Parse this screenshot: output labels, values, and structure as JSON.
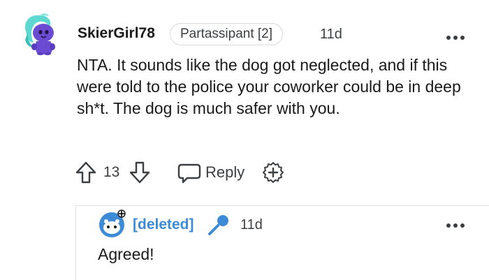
{
  "comment": {
    "username": "SkierGirl78",
    "flair": "Partassipant [2]",
    "timestamp": "11d",
    "body": "NTA. It sounds like the dog got neglected, and if this were told to the police your coworker could be in deep sh*t. The dog is much safer with you.",
    "vote_count": "13",
    "reply_label": "Reply",
    "avatar": "snoo-avatar-icon",
    "more_icon": "more-options-icon",
    "upvote_icon": "arrow-up-icon",
    "downvote_icon": "arrow-down-icon",
    "reply_icon": "speech-bubble-icon",
    "award_icon": "plus-award-icon"
  },
  "reply": {
    "username": "[deleted]",
    "timestamp": "11d",
    "body": "Agreed!",
    "avatar": "deleted-user-avatar-icon",
    "mic_icon": "microphone-icon",
    "more_icon": "more-options-icon"
  },
  "colors": {
    "text_primary": "#1a1a1b",
    "text_secondary": "#3c3f42",
    "deleted_user": "#3d8ad6",
    "flair_border": "#d7d9dc",
    "thread_line": "#e0e1e3",
    "avatar_primary": "#6a4bd1",
    "avatar_hair": "#5fd8d2"
  }
}
